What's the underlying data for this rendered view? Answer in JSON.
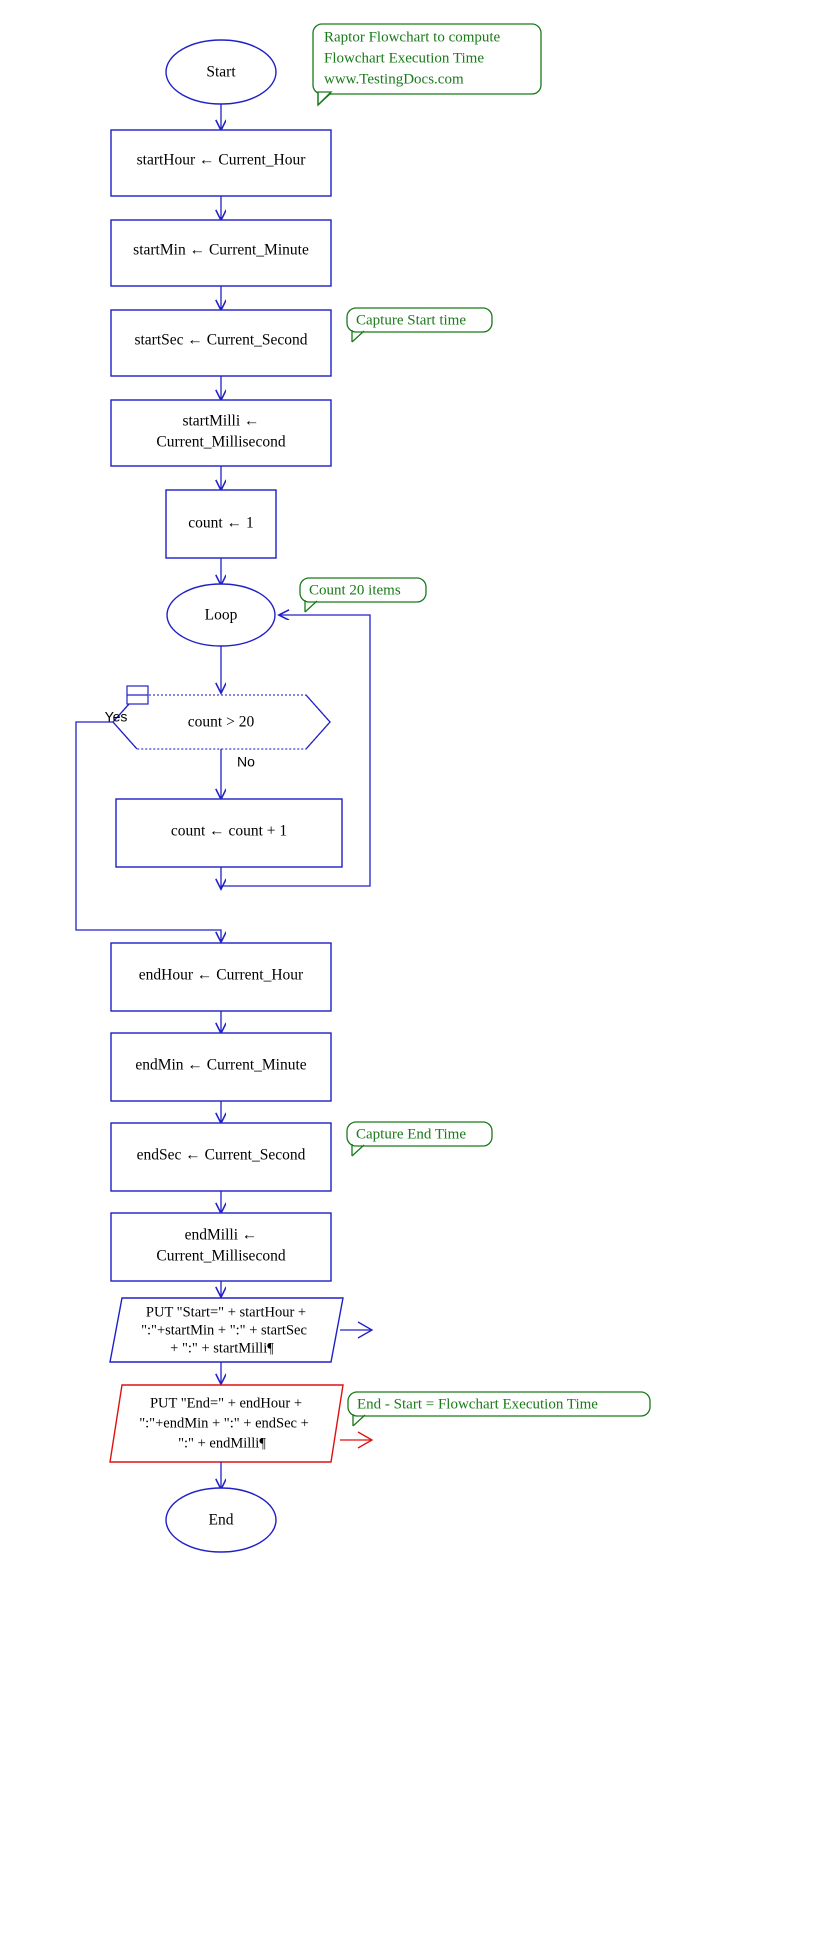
{
  "diagram": {
    "title": "Raptor Flowchart to compute Flowchart Execution Time",
    "tool": "Raptor"
  },
  "nodes": {
    "start": {
      "label": "Start",
      "shape": "oval"
    },
    "start_hour": {
      "label": "startHour ← Current_Hour",
      "shape": "process"
    },
    "start_min": {
      "label": "startMin ← Current_Minute",
      "shape": "process"
    },
    "start_sec": {
      "label": "startSec ← Current_Second",
      "shape": "process"
    },
    "start_milli": {
      "line1": "startMilli ←",
      "line2": "Current_Millisecond",
      "shape": "process"
    },
    "count_init": {
      "label": "count ← 1",
      "shape": "process"
    },
    "loop": {
      "label": "Loop",
      "shape": "oval"
    },
    "decision": {
      "label": "count > 20",
      "shape": "hexagon",
      "yes_label": "Yes",
      "no_label": "No"
    },
    "count_inc": {
      "label": "count ← count  +  1",
      "shape": "process"
    },
    "end_hour": {
      "label": "endHour ← Current_Hour",
      "shape": "process"
    },
    "end_min": {
      "label": "endMin ← Current_Minute",
      "shape": "process"
    },
    "end_sec": {
      "label": "endSec ← Current_Second",
      "shape": "process"
    },
    "end_milli": {
      "line1": "endMilli ←",
      "line2": "Current_Millisecond",
      "shape": "process"
    },
    "put_start": {
      "line1": "PUT \"Start=\" + startHour +",
      "line2": "\":\"+startMin + \":\" + startSec",
      "line3": "+ \":\" + startMilli¶",
      "shape": "parallelogram"
    },
    "put_end": {
      "line1": "PUT \"End=\" + endHour +",
      "line2": "\":\"+endMin + \":\" + endSec +",
      "line3": "\":\" + endMilli¶",
      "shape": "parallelogram",
      "selected": true
    },
    "end": {
      "label": "End",
      "shape": "oval"
    }
  },
  "comments": {
    "title_comment": {
      "line1": "Raptor Flowchart to compute",
      "line2": "Flowchart Execution Time",
      "line3": "www.TestingDocs.com"
    },
    "capture_start": {
      "line1": "Capture Start time"
    },
    "count_items": {
      "line1": "Count 20 items"
    },
    "capture_end": {
      "line1": "Capture End Time"
    },
    "exec_time": {
      "line1": "End - Start = Flowchart Execution Time"
    }
  },
  "colors": {
    "shape_blue": "#2020c8",
    "shape_red": "#e01010",
    "comment_green": "#1a7a1a",
    "text_black": "#000000",
    "background": "#ffffff"
  }
}
